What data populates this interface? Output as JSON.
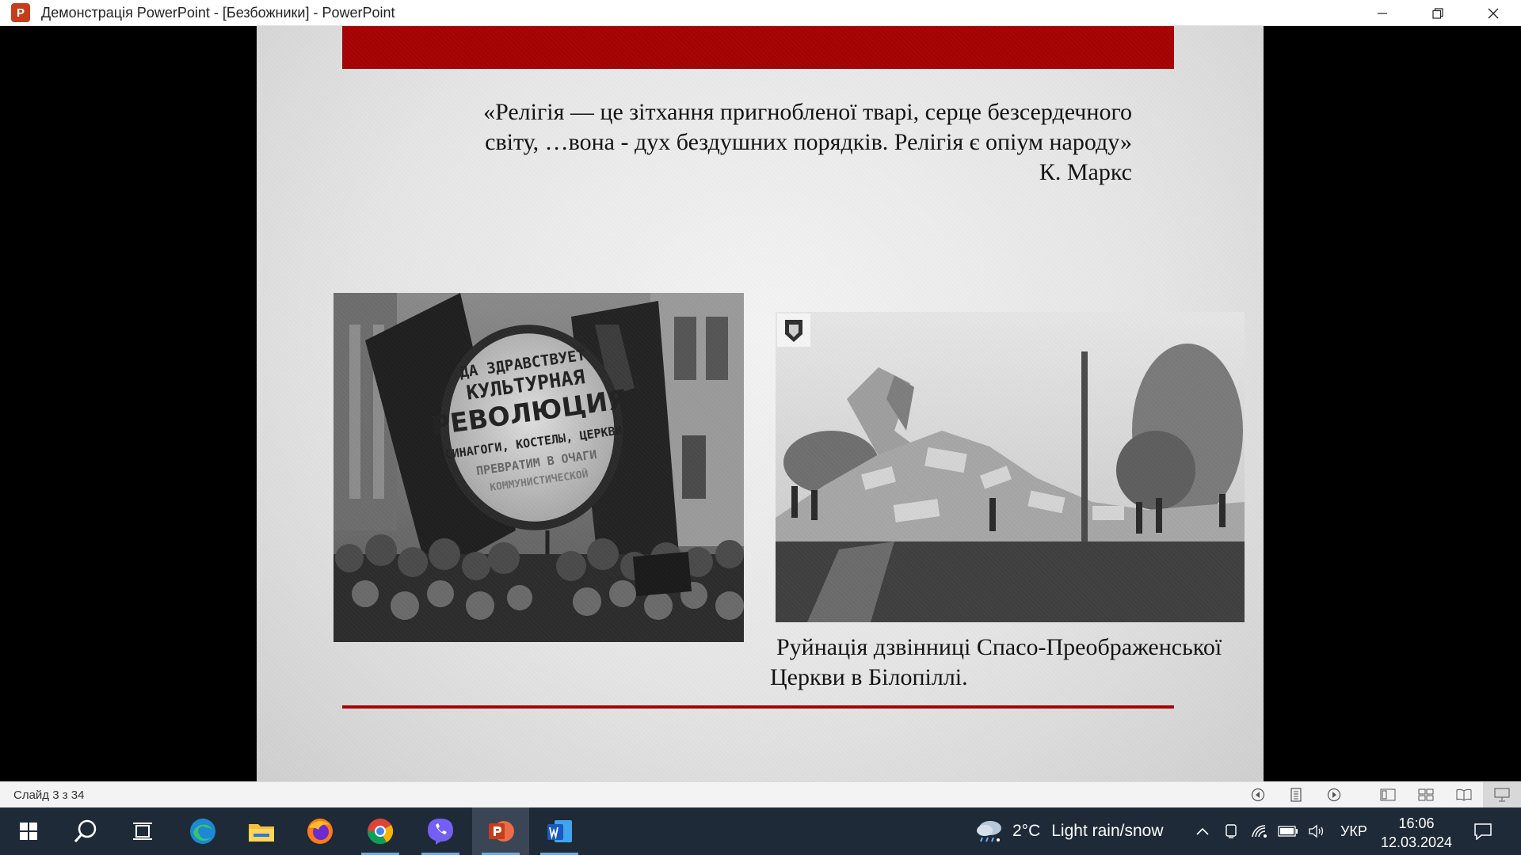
{
  "window": {
    "title": "Демонстрація PowerPoint - [Безбожники] - PowerPoint",
    "app_icon": "powerpoint-icon",
    "app_icon_letter": "P",
    "controls": [
      "minimize-icon",
      "restore-icon",
      "close-icon"
    ]
  },
  "slide": {
    "accent_color": "#a50202",
    "quote_lines": [
      "«Релігія — це зітхання пригнобленої тварі, серце безсердечного",
      "світу, …вона - дух бездушних порядків. Релігія є опіум народу»",
      "К. Маркс"
    ],
    "images": {
      "left": {
        "banner_lines": [
          "ДА ЗДРАВСТВУЕТ",
          "КУЛЬТУРНАЯ",
          "РЕВОЛЮЦИЯ",
          "СИНАГОГИ, КОСТЕЛЫ, ЦЕРКВИ",
          "ПРЕВРАТИМ В ОЧАГИ",
          "КОММУНИСТИЧЕСКОЙ"
        ]
      },
      "right": {
        "watermark_icon": "coat-of-arms-icon"
      }
    },
    "caption_lines": [
      "Руйнація дзвінниці Спасо-Преображенської",
      "Церкви в Білопіллі."
    ]
  },
  "statusbar": {
    "slide_counter": "Слайд 3 з 34",
    "icons": [
      "previous-slide-icon",
      "slide-menu-icon",
      "next-slide-icon",
      "normal-view-icon",
      "slide-sorter-icon",
      "reading-view-icon",
      "slideshow-icon"
    ]
  },
  "taskbar": {
    "apps": [
      "start-icon",
      "search-icon",
      "task-view-icon",
      "edge-icon",
      "file-explorer-icon",
      "firefox-icon",
      "chrome-icon",
      "viber-icon",
      "powerpoint-icon",
      "word-icon"
    ],
    "weather": {
      "temp": "2°C",
      "condition": "Light rain/snow"
    },
    "language": "УКР",
    "time": "16:06",
    "date": "12.03.2024"
  }
}
